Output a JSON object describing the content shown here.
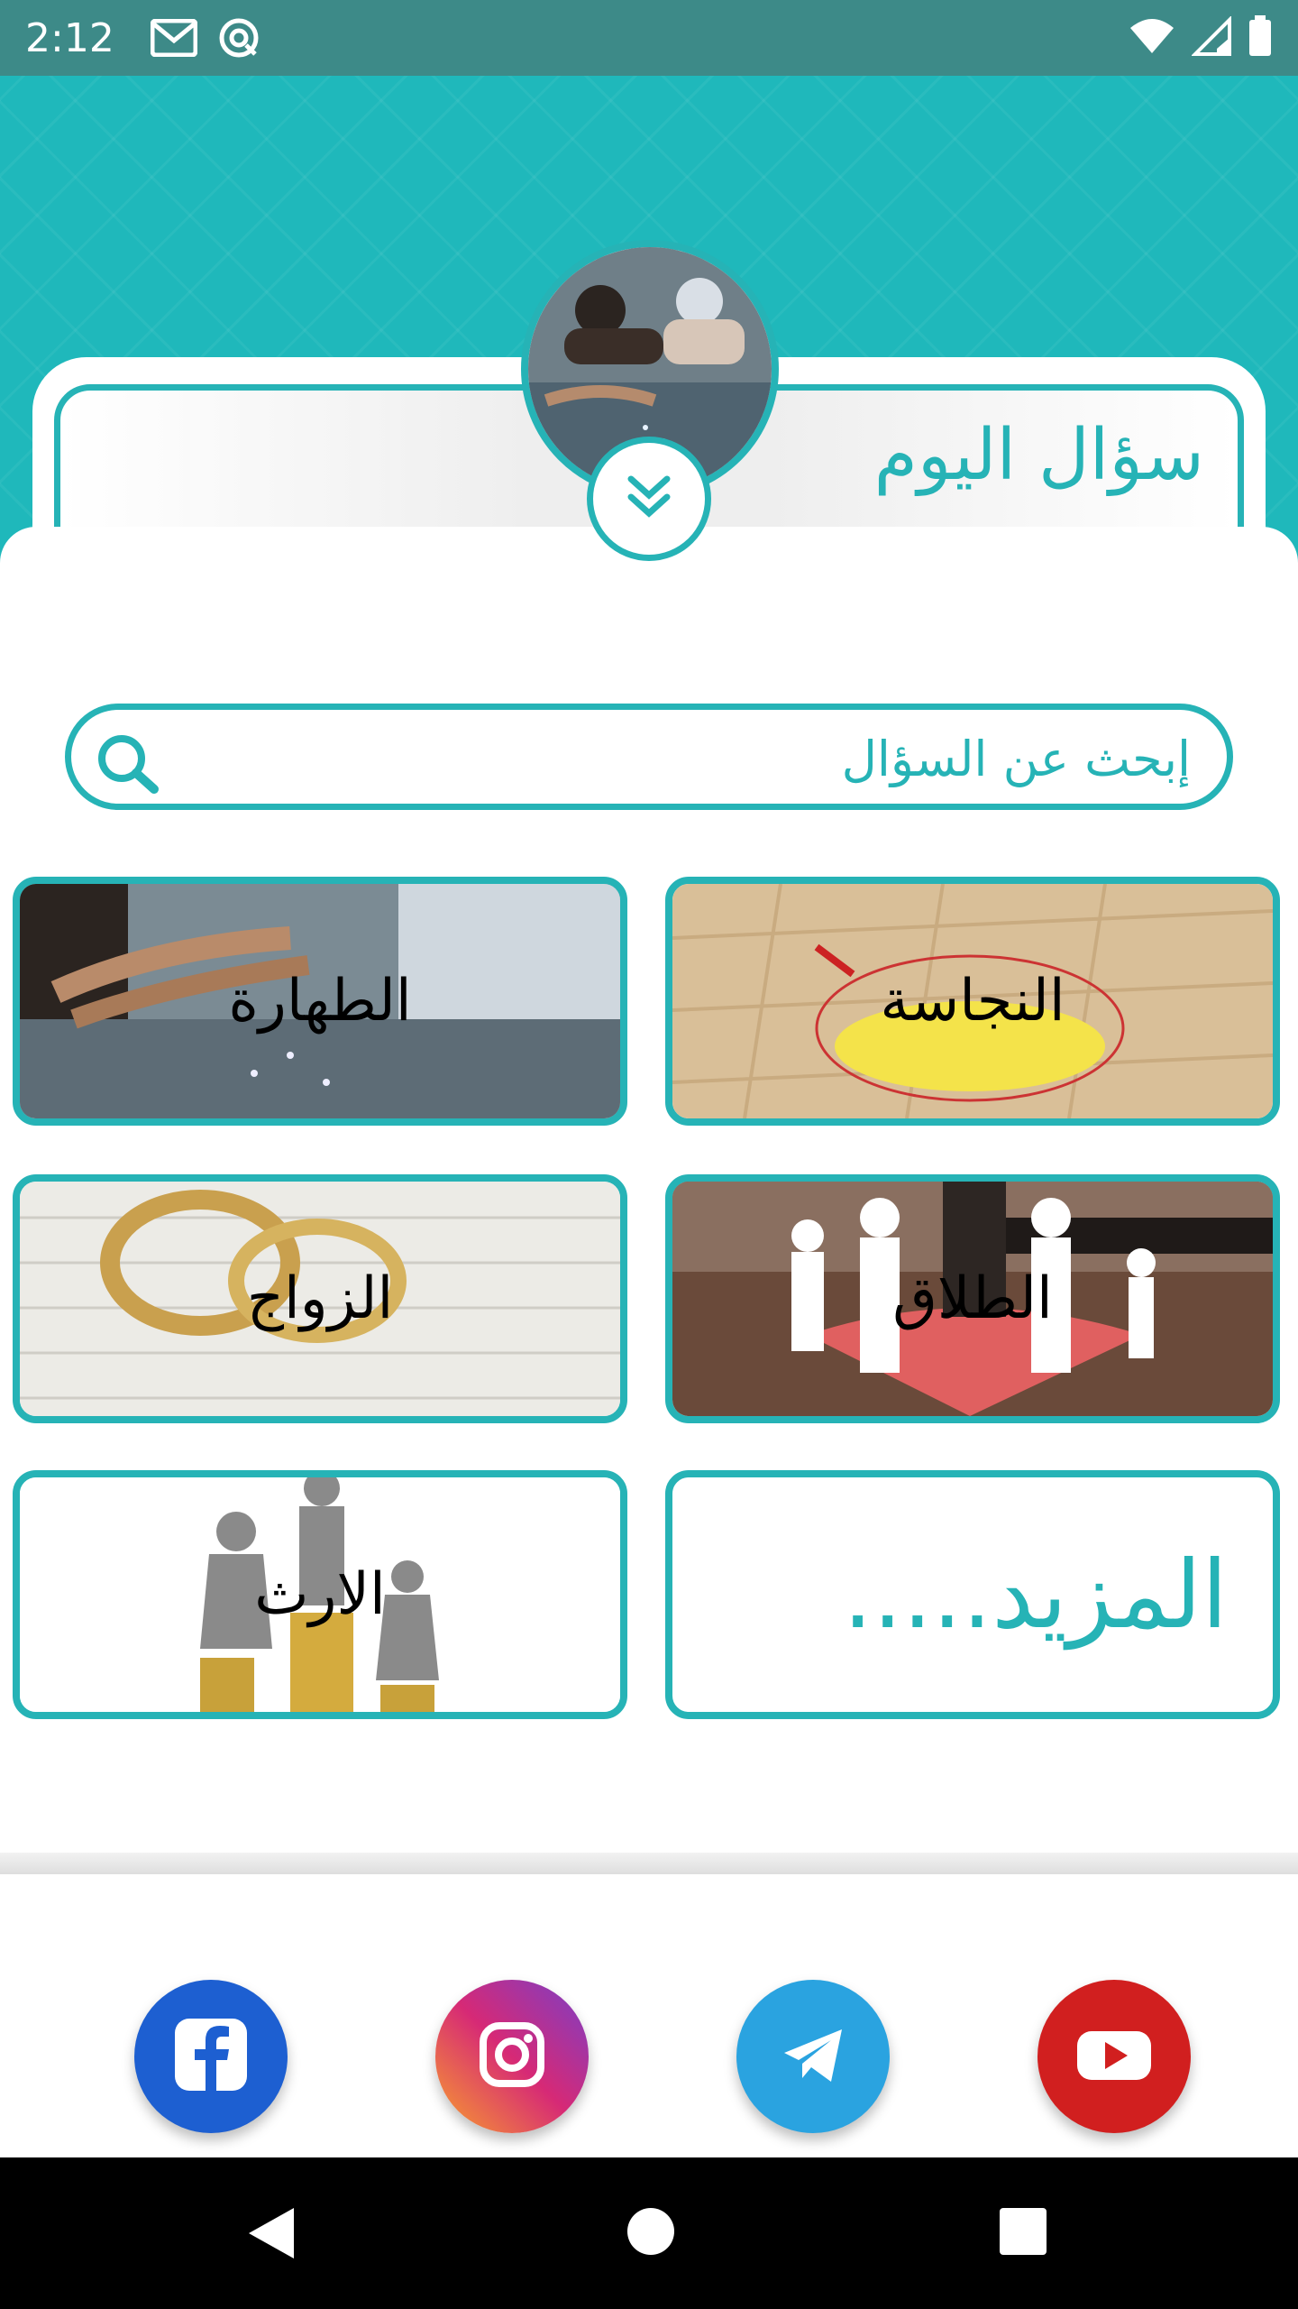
{
  "status_bar": {
    "time": "2:12",
    "icons": [
      "gmail-icon",
      "sync-icon",
      "wifi-icon",
      "signal-icon",
      "battery-icon"
    ]
  },
  "header": {
    "question_of_day_title": "سؤال اليوم",
    "expand_icon": "double-chevron-down-icon"
  },
  "search": {
    "placeholder": "إبحث عن السؤال",
    "icon": "search-icon"
  },
  "categories": [
    {
      "label": "النجاسة"
    },
    {
      "label": "الطهارة"
    },
    {
      "label": "الطلاق"
    },
    {
      "label": "الزواج"
    },
    {
      "label": "المزيد....."
    },
    {
      "label": "الارث"
    }
  ],
  "social": [
    {
      "name": "facebook",
      "icon": "facebook-icon",
      "color": "#1d5fd1"
    },
    {
      "name": "instagram",
      "icon": "instagram-icon",
      "color": "#d62976"
    },
    {
      "name": "telegram",
      "icon": "telegram-icon",
      "color": "#2aa3e0"
    },
    {
      "name": "youtube",
      "icon": "youtube-icon",
      "color": "#d11f1f"
    }
  ],
  "navigation": [
    "back-icon",
    "home-icon",
    "recents-icon"
  ],
  "colors": {
    "accent": "#26b3b6",
    "header_bg": "#1fb8bb",
    "status_bar": "#3d8a88"
  }
}
